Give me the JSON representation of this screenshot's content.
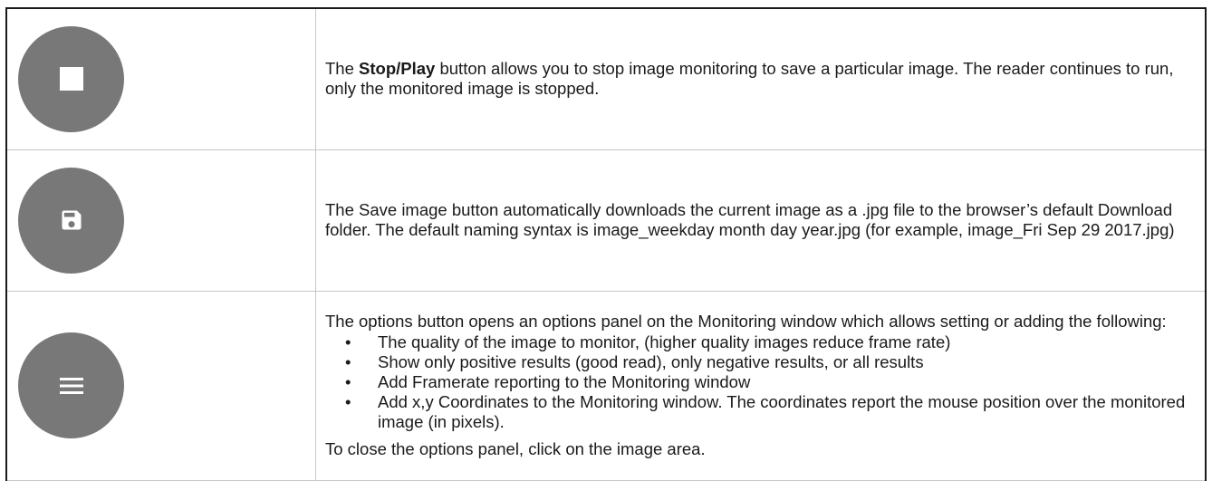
{
  "rows": {
    "stop": {
      "icon": "stop-icon",
      "prefix": "The ",
      "bold": "Stop/Play",
      "suffix": " button allows you to stop image monitoring to save a particular image. The reader continues to run, only the monitored image is stopped."
    },
    "save": {
      "icon": "save-icon",
      "text": "The Save image button automatically downloads the current image as a .jpg file to the browser’s default Download folder. The default naming syntax is image_weekday month day year.jpg (for example, image_Fri Sep 29 2017.jpg)"
    },
    "options": {
      "icon": "menu-icon",
      "intro": "The options button opens an options panel on the Monitoring window which allows setting or adding the following:",
      "bullet_char": "•",
      "bullets": [
        "The quality of the image to monitor, (higher quality images reduce frame rate)",
        "Show only positive results (good read), only negative results, or all results",
        "Add Framerate reporting to the Monitoring window",
        "Add x,y Coordinates to the Monitoring window. The coordinates report the mouse position over the monitored image (in pixels)."
      ],
      "closing": "To close the options panel, click on the image area."
    }
  },
  "colors": {
    "icon_circle": "#787878",
    "icon_glyph": "#ffffff",
    "border": "#c7c7c7"
  }
}
